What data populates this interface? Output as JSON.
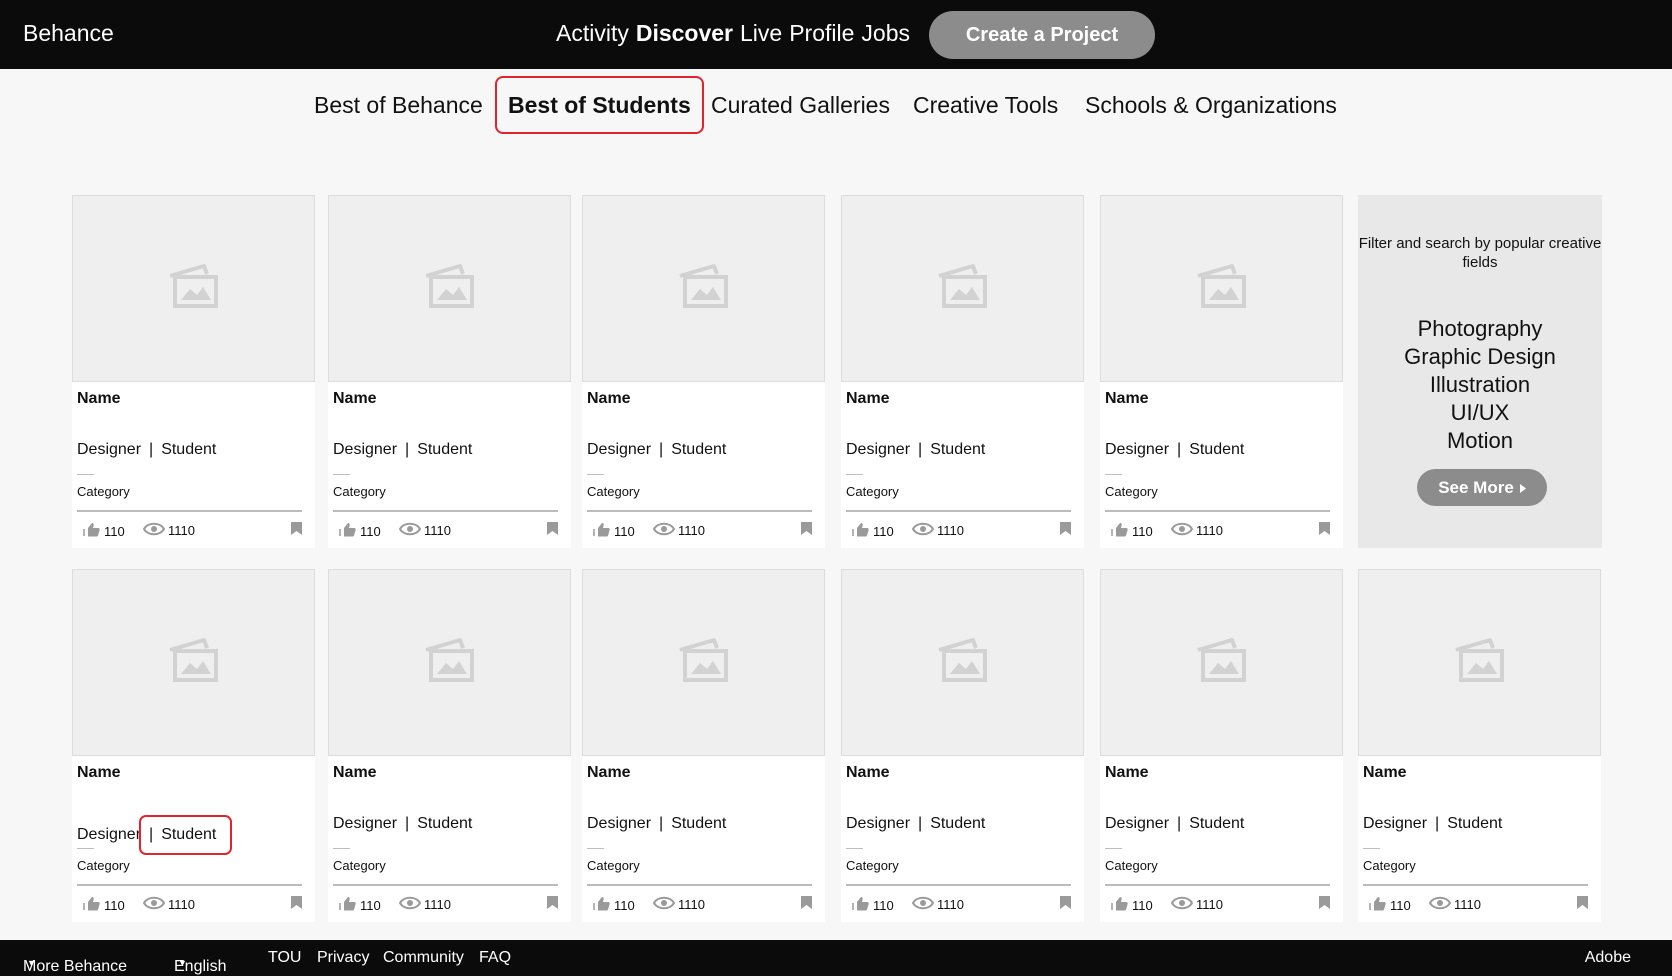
{
  "header": {
    "brand": "Behance",
    "nav": [
      "Activity",
      "Discover",
      "Live",
      "Profile",
      "Jobs"
    ],
    "active_nav": "Discover",
    "create_label": "Create a Project",
    "button_color": "#8c8c8c"
  },
  "subnav": {
    "tabs": [
      "Best of Behance",
      "Best of Students",
      "Curated Galleries",
      "Creative Tools",
      "Schools & Organizations"
    ],
    "active": "Best of Students",
    "highlight_color": "#e0252e"
  },
  "cards": [
    {
      "name": "Name",
      "role": "Designer",
      "tag": "Student",
      "category": "Category",
      "likes": "110",
      "views": "1110",
      "thumb_icon": "image-placeholder-icon"
    },
    {
      "name": "Name",
      "role": "Designer",
      "tag": "Student",
      "category": "Category",
      "likes": "110",
      "views": "1110",
      "thumb_icon": "image-placeholder-icon"
    },
    {
      "name": "Name",
      "role": "Designer",
      "tag": "Student",
      "category": "Category",
      "likes": "110",
      "views": "1110",
      "thumb_icon": "image-placeholder-icon"
    },
    {
      "name": "Name",
      "role": "Designer",
      "tag": "Student",
      "category": "Category",
      "likes": "110",
      "views": "1110",
      "thumb_icon": "image-placeholder-icon"
    },
    {
      "name": "Name",
      "role": "Designer",
      "tag": "Student",
      "category": "Category",
      "likes": "110",
      "views": "1110",
      "thumb_icon": "image-placeholder-icon"
    },
    {
      "name": "Name",
      "role": "Designer",
      "tag": "Student",
      "category": "Category",
      "likes": "110",
      "views": "1110",
      "thumb_icon": "image-placeholder-icon",
      "highlight": "tag"
    },
    {
      "name": "Name",
      "role": "Designer",
      "tag": "Student",
      "category": "Category",
      "likes": "110",
      "views": "1110",
      "thumb_icon": "image-placeholder-icon"
    },
    {
      "name": "Name",
      "role": "Designer",
      "tag": "Student",
      "category": "Category",
      "likes": "110",
      "views": "1110",
      "thumb_icon": "image-placeholder-icon"
    },
    {
      "name": "Name",
      "role": "Designer",
      "tag": "Student",
      "category": "Category",
      "likes": "110",
      "views": "1110",
      "thumb_icon": "image-placeholder-icon"
    },
    {
      "name": "Name",
      "role": "Designer",
      "tag": "Student",
      "category": "Category",
      "likes": "110",
      "views": "1110",
      "thumb_icon": "image-placeholder-icon"
    },
    {
      "name": "Name",
      "role": "Designer",
      "tag": "Student",
      "category": "Category",
      "likes": "110",
      "views": "1110",
      "thumb_icon": "image-placeholder-icon"
    }
  ],
  "filter_panel": {
    "intro": "Filter and search by popular creative fields",
    "fields": [
      "Photography",
      "Graphic Design",
      "Illustration",
      "UI/UX",
      "Motion"
    ],
    "see_more_label": "See More"
  },
  "footer": {
    "links": [
      "More Behance",
      "English",
      "TOU",
      "Privacy",
      "Community",
      "FAQ"
    ],
    "dropdown_links": [
      "More Behance",
      "English"
    ],
    "right_label": "Adobe"
  },
  "icons": {
    "thumb": "image-placeholder-icon",
    "likes": "thumbs-up-icon",
    "views": "eye-icon",
    "save": "bookmark-icon",
    "dropdown": "caret-down-icon",
    "see_more": "caret-right-icon"
  }
}
